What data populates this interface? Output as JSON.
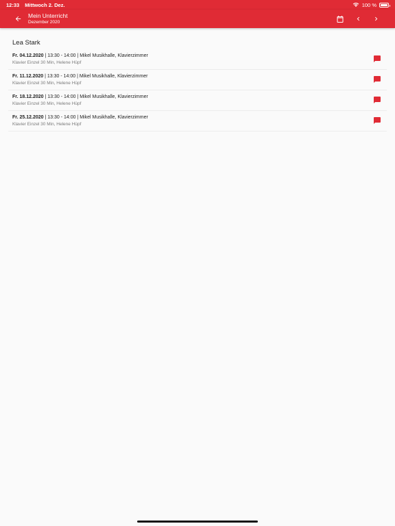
{
  "status_bar": {
    "time": "12:33",
    "date": "Mittwoch 2. Dez.",
    "battery_text": "100 %"
  },
  "app_bar": {
    "title": "Mein Unterricht",
    "subtitle": "Dezember 2020",
    "icons": [
      "arrow-back-icon",
      "calendar-icon",
      "chevron-left-icon",
      "chevron-right-icon"
    ]
  },
  "student": {
    "name": "Lea Stark"
  },
  "lessons": [
    {
      "date": "Fr. 04.12.2020",
      "sep1": " | ",
      "details": "13:30 - 14:00 | Mikel Musikhalle, Klavierzimmer",
      "subtitle": "Klavier Einzel 30 Min, Helene Hüpf"
    },
    {
      "date": "Fr. 11.12.2020",
      "sep1": " | ",
      "details": "13:30 - 14:00 | Mikel Musikhalle, Klavierzimmer",
      "subtitle": "Klavier Einzel 30 Min, Helene Hüpf"
    },
    {
      "date": "Fr. 18.12.2020",
      "sep1": " | ",
      "details": "13:30 - 14:00 | Mikel Musikhalle, Klavierzimmer",
      "subtitle": "Klavier Einzel 30 Min, Helene Hüpf"
    },
    {
      "date": "Fr. 25.12.2020",
      "sep1": " | ",
      "details": "13:30 - 14:00 | Mikel Musikhalle, Klavierzimmer",
      "subtitle": "Klavier Einzel 30 Min, Helene Hüpf"
    }
  ],
  "colors": {
    "accent": "#e02b35",
    "background": "#fafafa"
  }
}
